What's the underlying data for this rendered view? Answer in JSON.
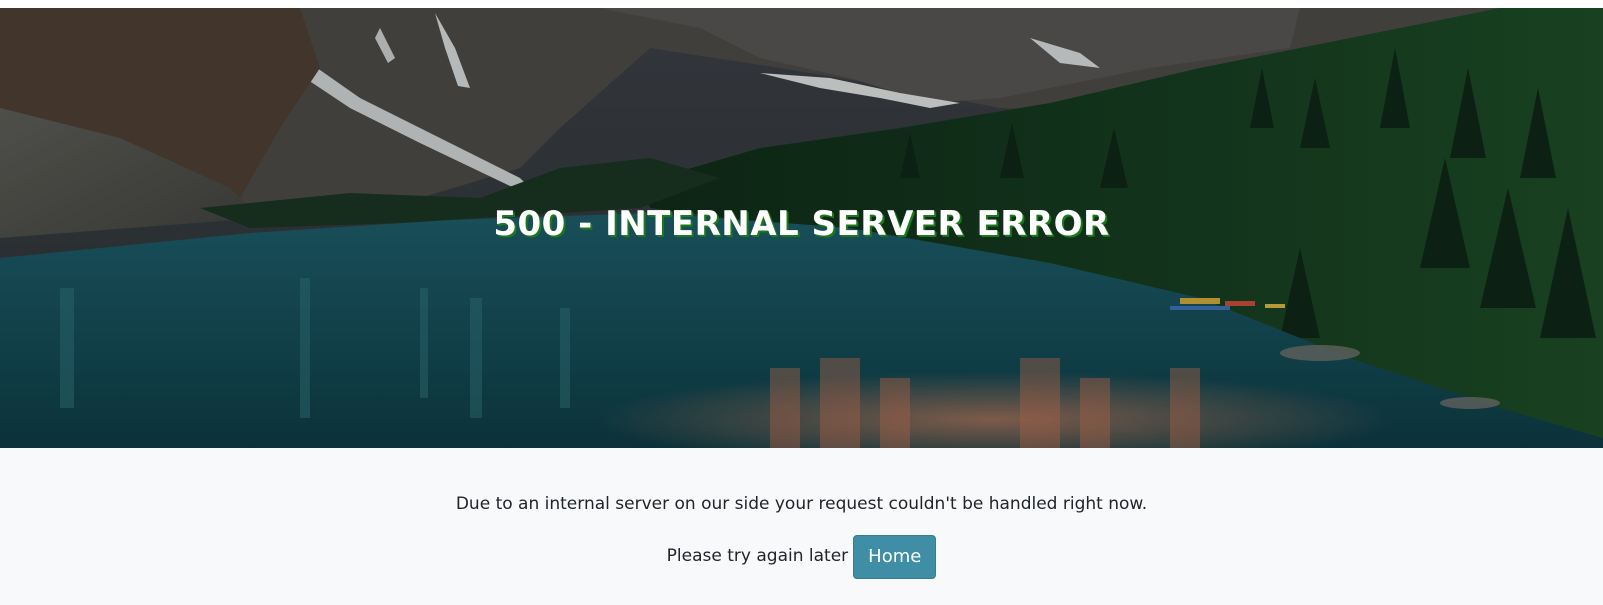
{
  "hero": {
    "title": "500 - INTERNAL SERVER ERROR",
    "image_description_icon": "mountain-lake-landscape"
  },
  "content": {
    "message": "Due to an internal server on our side your request couldn't be handled right now.",
    "retry_text": "Please try again later",
    "home_button_label": "Home"
  },
  "colors": {
    "page_background": "#f8f9fa",
    "button_background": "#3f8ea6",
    "title_color": "#ffffff",
    "title_shadow": "#1a7a1a",
    "text_color": "#212529"
  }
}
